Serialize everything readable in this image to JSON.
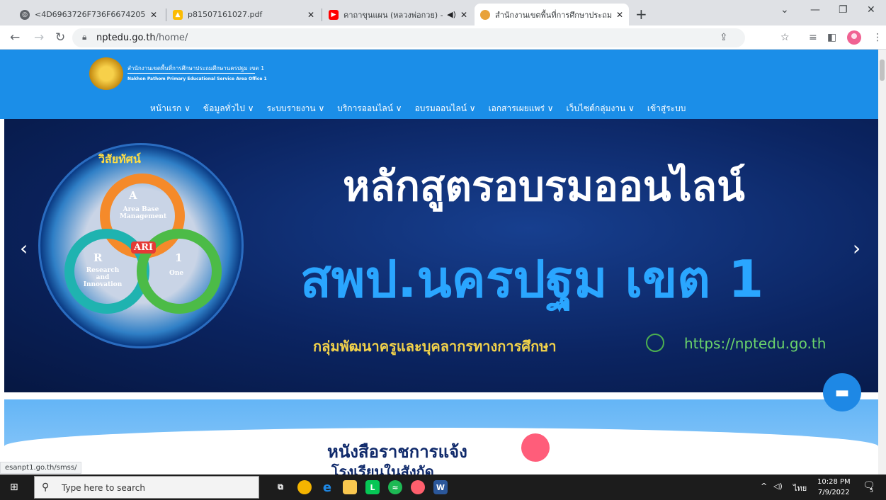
{
  "tabs": [
    {
      "title": "<4D6963726F736F667420576F7",
      "favicon": "globe-icon"
    },
    {
      "title": "p81507161027.pdf",
      "favicon": "drive-icon"
    },
    {
      "title": "คาถาขุนแผน (หลวงพ่อกวย) - กา",
      "favicon": "youtube-icon"
    },
    {
      "title": "สำนักงานเขตพื้นที่การศึกษาประถมศึก",
      "favicon": "site-icon"
    }
  ],
  "address_bar": {
    "domain": "nptedu.go.th",
    "path": "/home/"
  },
  "site": {
    "org_name_th": "สำนักงานเขตพื้นที่การศึกษาประถมศึกษานครปฐม เขต 1",
    "org_name_en": "Nakhon Pathom Primary Educational Service Area Office 1",
    "menu": [
      "หน้าแรก ∨",
      "ข้อมูลทั่วไป ∨",
      "ระบบรายงาน ∨",
      "บริการออนไลน์ ∨",
      "อบรมออนไลน์ ∨",
      "เอกสารเผยแพร่ ∨",
      "เว็บไซต์กลุ่มงาน ∨",
      "เข้าสู่ระบบ"
    ]
  },
  "banner": {
    "vision_title": "วิสัยทัศน์",
    "ring_a_letter": "A",
    "ring_a_text": "Area Base Management",
    "ring_r_letter": "R",
    "ring_r_text": "Research and Innovation",
    "ring_1_letter": "1",
    "ring_1_text": "One",
    "center": "ARI",
    "headline1": "หลักสูตรอบรมออนไลน์",
    "headline2": "สพป.นครปฐม เขต 1",
    "footer_text": "กลุ่มพัฒนาครูและบุคลากรทางการศึกษา",
    "footer_url": "https://nptedu.go.th"
  },
  "section2": {
    "title": "หนังสือราชการแจ้ง",
    "subtitle": "โรงเรียนในสังกัด"
  },
  "status_url": "esanpt1.go.th/smss/",
  "taskbar": {
    "search_placeholder": "Type here to search",
    "lang": "ไทย",
    "time": "10:28 PM",
    "date": "7/9/2022",
    "notif_count": "5"
  }
}
